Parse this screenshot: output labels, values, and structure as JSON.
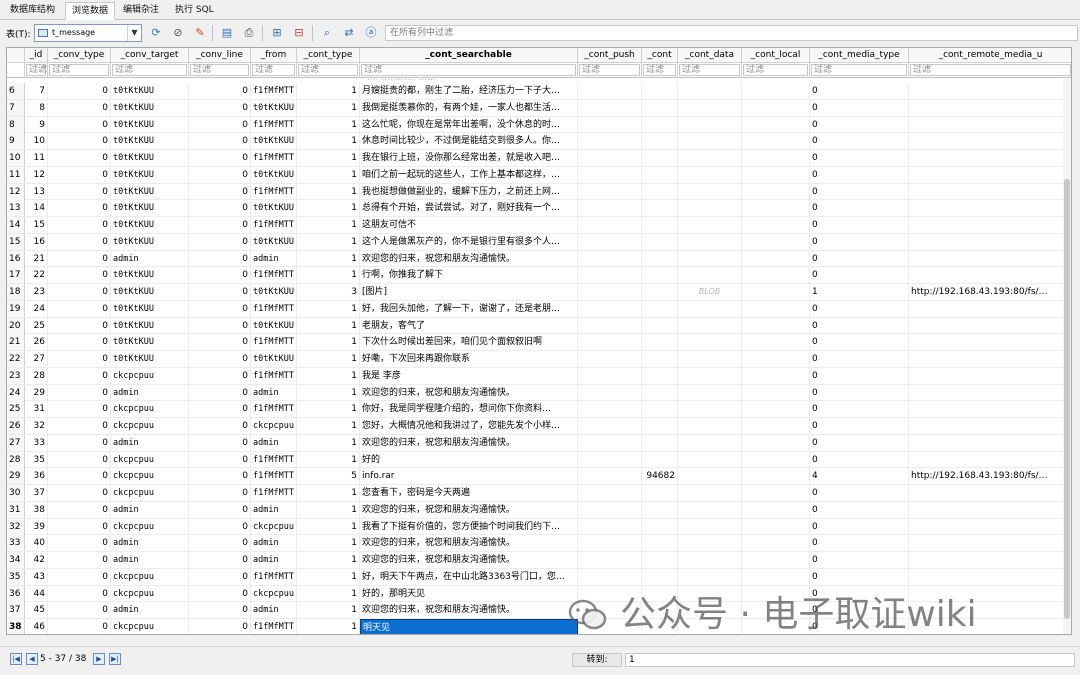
{
  "tabs": [
    "数据库结构",
    "浏览数据",
    "编辑杂注",
    "执行 SQL"
  ],
  "toolbar": {
    "table_label": "表(T):",
    "table_name": "t_message",
    "filter_all_placeholder": "在所有列中过滤"
  },
  "grid": {
    "columns": [
      "",
      "_id",
      "_conv_type",
      "_conv_target",
      "_conv_line",
      "_from",
      "_cont_type",
      "_cont_searchable",
      "_cont_push",
      "_cont",
      "_cont_data",
      "_cont_local",
      "_cont_media_type",
      "_cont_remote_media_u"
    ],
    "filter_placeholder": "过滤",
    "rows": [
      {
        "rn": "6",
        "id": "7",
        "conv_type": "0",
        "conv_target": "t0tKtKUU",
        "conv_line": "0",
        "from": "f1fMfMTT",
        "cont_type": "1",
        "searchable": "月嫂挺贵的都，刚生了二胎，经济压力一下子大…",
        "push": "",
        "cont": "",
        "data": "",
        "local": "",
        "media_type": "0",
        "remote": ""
      },
      {
        "rn": "7",
        "id": "8",
        "conv_type": "0",
        "conv_target": "t0tKtKUU",
        "conv_line": "0",
        "from": "t0tKtKUU",
        "cont_type": "1",
        "searchable": "我倒是挺羡慕你的，有两个娃，一家人也都生活…",
        "push": "",
        "cont": "",
        "data": "",
        "local": "",
        "media_type": "0",
        "remote": ""
      },
      {
        "rn": "8",
        "id": "9",
        "conv_type": "0",
        "conv_target": "t0tKtKUU",
        "conv_line": "0",
        "from": "f1fMfMTT",
        "cont_type": "1",
        "searchable": "这么忙呢，你现在是常年出差啊，没个休息的时…",
        "push": "",
        "cont": "",
        "data": "",
        "local": "",
        "media_type": "0",
        "remote": ""
      },
      {
        "rn": "9",
        "id": "10",
        "conv_type": "0",
        "conv_target": "t0tKtKUU",
        "conv_line": "0",
        "from": "t0tKtKUU",
        "cont_type": "1",
        "searchable": "休息时间比较少，不过倒是能结交到很多人。你…",
        "push": "",
        "cont": "",
        "data": "",
        "local": "",
        "media_type": "0",
        "remote": ""
      },
      {
        "rn": "10",
        "id": "11",
        "conv_type": "0",
        "conv_target": "t0tKtKUU",
        "conv_line": "0",
        "from": "f1fMfMTT",
        "cont_type": "1",
        "searchable": "我在银行上班，没你那么经常出差，就是收入吧…",
        "push": "",
        "cont": "",
        "data": "",
        "local": "",
        "media_type": "0",
        "remote": ""
      },
      {
        "rn": "11",
        "id": "12",
        "conv_type": "0",
        "conv_target": "t0tKtKUU",
        "conv_line": "0",
        "from": "t0tKtKUU",
        "cont_type": "1",
        "searchable": "咱们之前一起玩的这些人，工作上基本都这样，…",
        "push": "",
        "cont": "",
        "data": "",
        "local": "",
        "media_type": "0",
        "remote": ""
      },
      {
        "rn": "12",
        "id": "13",
        "conv_type": "0",
        "conv_target": "t0tKtKUU",
        "conv_line": "0",
        "from": "f1fMfMTT",
        "cont_type": "1",
        "searchable": "我也挺想做做副业的，缓解下压力，之前还上网…",
        "push": "",
        "cont": "",
        "data": "",
        "local": "",
        "media_type": "0",
        "remote": ""
      },
      {
        "rn": "13",
        "id": "14",
        "conv_type": "0",
        "conv_target": "t0tKtKUU",
        "conv_line": "0",
        "from": "t0tKtKUU",
        "cont_type": "1",
        "searchable": "总得有个开始，尝试尝试。对了，刚好我有一个…",
        "push": "",
        "cont": "",
        "data": "",
        "local": "",
        "media_type": "0",
        "remote": ""
      },
      {
        "rn": "14",
        "id": "15",
        "conv_type": "0",
        "conv_target": "t0tKtKUU",
        "conv_line": "0",
        "from": "f1fMfMTT",
        "cont_type": "1",
        "searchable": "这朋友可信不",
        "push": "",
        "cont": "",
        "data": "",
        "local": "",
        "media_type": "0",
        "remote": ""
      },
      {
        "rn": "15",
        "id": "16",
        "conv_type": "0",
        "conv_target": "t0tKtKUU",
        "conv_line": "0",
        "from": "t0tKtKUU",
        "cont_type": "1",
        "searchable": "这个人是做黑灰产的，你不是银行里有很多个人…",
        "push": "",
        "cont": "",
        "data": "",
        "local": "",
        "media_type": "0",
        "remote": ""
      },
      {
        "rn": "16",
        "id": "21",
        "conv_type": "0",
        "conv_target": "admin",
        "conv_line": "0",
        "from": "admin",
        "cont_type": "1",
        "searchable": "欢迎您的归来，祝您和朋友沟通愉快。",
        "push": "",
        "cont": "",
        "data": "",
        "local": "",
        "media_type": "0",
        "remote": ""
      },
      {
        "rn": "17",
        "id": "22",
        "conv_type": "0",
        "conv_target": "t0tKtKUU",
        "conv_line": "0",
        "from": "f1fMfMTT",
        "cont_type": "1",
        "searchable": "行啊，你推我了解下",
        "push": "",
        "cont": "",
        "data": "",
        "local": "",
        "media_type": "0",
        "remote": ""
      },
      {
        "rn": "18",
        "id": "23",
        "conv_type": "0",
        "conv_target": "t0tKtKUU",
        "conv_line": "0",
        "from": "t0tKtKUU",
        "cont_type": "3",
        "searchable": "[图片]",
        "push": "",
        "cont": "",
        "data": "BLOB",
        "local": "",
        "media_type": "1",
        "remote": "http://192.168.43.193:80/fs/…"
      },
      {
        "rn": "19",
        "id": "24",
        "conv_type": "0",
        "conv_target": "t0tKtKUU",
        "conv_line": "0",
        "from": "f1fMfMTT",
        "cont_type": "1",
        "searchable": "好，我回头加他，了解一下，谢谢了，还是老朋…",
        "push": "",
        "cont": "",
        "data": "",
        "local": "",
        "media_type": "0",
        "remote": ""
      },
      {
        "rn": "20",
        "id": "25",
        "conv_type": "0",
        "conv_target": "t0tKtKUU",
        "conv_line": "0",
        "from": "t0tKtKUU",
        "cont_type": "1",
        "searchable": "老朋友，客气了",
        "push": "",
        "cont": "",
        "data": "",
        "local": "",
        "media_type": "0",
        "remote": ""
      },
      {
        "rn": "21",
        "id": "26",
        "conv_type": "0",
        "conv_target": "t0tKtKUU",
        "conv_line": "0",
        "from": "f1fMfMTT",
        "cont_type": "1",
        "searchable": "下次什么时候出差回来，咱们见个面叙叙旧啊",
        "push": "",
        "cont": "",
        "data": "",
        "local": "",
        "media_type": "0",
        "remote": ""
      },
      {
        "rn": "22",
        "id": "27",
        "conv_type": "0",
        "conv_target": "t0tKtKUU",
        "conv_line": "0",
        "from": "t0tKtKUU",
        "cont_type": "1",
        "searchable": "好嘞，下次回来再跟你联系",
        "push": "",
        "cont": "",
        "data": "",
        "local": "",
        "media_type": "0",
        "remote": ""
      },
      {
        "rn": "23",
        "id": "28",
        "conv_type": "0",
        "conv_target": "ckcpcpuu",
        "conv_line": "0",
        "from": "f1fMfMTT",
        "cont_type": "1",
        "searchable": "我是 李彦",
        "push": "",
        "cont": "",
        "data": "",
        "local": "",
        "media_type": "0",
        "remote": ""
      },
      {
        "rn": "24",
        "id": "29",
        "conv_type": "0",
        "conv_target": "admin",
        "conv_line": "0",
        "from": "admin",
        "cont_type": "1",
        "searchable": "欢迎您的归来，祝您和朋友沟通愉快。",
        "push": "",
        "cont": "",
        "data": "",
        "local": "",
        "media_type": "0",
        "remote": ""
      },
      {
        "rn": "25",
        "id": "31",
        "conv_type": "0",
        "conv_target": "ckcpcpuu",
        "conv_line": "0",
        "from": "f1fMfMTT",
        "cont_type": "1",
        "searchable": "你好，我是同学程隆介绍的，想问你下你资料…",
        "push": "",
        "cont": "",
        "data": "",
        "local": "",
        "media_type": "0",
        "remote": ""
      },
      {
        "rn": "26",
        "id": "32",
        "conv_type": "0",
        "conv_target": "ckcpcpuu",
        "conv_line": "0",
        "from": "ckcpcpuu",
        "cont_type": "1",
        "searchable": "您好，大概情况他和我讲过了，您能先发个小样…",
        "push": "",
        "cont": "",
        "data": "",
        "local": "",
        "media_type": "0",
        "remote": ""
      },
      {
        "rn": "27",
        "id": "33",
        "conv_type": "0",
        "conv_target": "admin",
        "conv_line": "0",
        "from": "admin",
        "cont_type": "1",
        "searchable": "欢迎您的归来，祝您和朋友沟通愉快。",
        "push": "",
        "cont": "",
        "data": "",
        "local": "",
        "media_type": "0",
        "remote": ""
      },
      {
        "rn": "28",
        "id": "35",
        "conv_type": "0",
        "conv_target": "ckcpcpuu",
        "conv_line": "0",
        "from": "f1fMfMTT",
        "cont_type": "1",
        "searchable": "好的",
        "push": "",
        "cont": "",
        "data": "",
        "local": "",
        "media_type": "0",
        "remote": ""
      },
      {
        "rn": "29",
        "id": "36",
        "conv_type": "0",
        "conv_target": "ckcpcpuu",
        "conv_line": "0",
        "from": "f1fMfMTT",
        "cont_type": "5",
        "searchable": "info.rar",
        "push": "",
        "cont": "94682",
        "data": "",
        "local": "",
        "media_type": "4",
        "remote": "http://192.168.43.193:80/fs/…"
      },
      {
        "rn": "30",
        "id": "37",
        "conv_type": "0",
        "conv_target": "ckcpcpuu",
        "conv_line": "0",
        "from": "f1fMfMTT",
        "cont_type": "1",
        "searchable": "您查看下，密码是今天两遍",
        "push": "",
        "cont": "",
        "data": "",
        "local": "",
        "media_type": "0",
        "remote": ""
      },
      {
        "rn": "31",
        "id": "38",
        "conv_type": "0",
        "conv_target": "admin",
        "conv_line": "0",
        "from": "admin",
        "cont_type": "1",
        "searchable": "欢迎您的归来，祝您和朋友沟通愉快。",
        "push": "",
        "cont": "",
        "data": "",
        "local": "",
        "media_type": "0",
        "remote": ""
      },
      {
        "rn": "32",
        "id": "39",
        "conv_type": "0",
        "conv_target": "ckcpcpuu",
        "conv_line": "0",
        "from": "ckcpcpuu",
        "cont_type": "1",
        "searchable": "我看了下挺有价值的，您方便抽个时间我们约下…",
        "push": "",
        "cont": "",
        "data": "",
        "local": "",
        "media_type": "0",
        "remote": ""
      },
      {
        "rn": "33",
        "id": "40",
        "conv_type": "0",
        "conv_target": "admin",
        "conv_line": "0",
        "from": "admin",
        "cont_type": "1",
        "searchable": "欢迎您的归来，祝您和朋友沟通愉快。",
        "push": "",
        "cont": "",
        "data": "",
        "local": "",
        "media_type": "0",
        "remote": ""
      },
      {
        "rn": "34",
        "id": "42",
        "conv_type": "0",
        "conv_target": "admin",
        "conv_line": "0",
        "from": "admin",
        "cont_type": "1",
        "searchable": "欢迎您的归来，祝您和朋友沟通愉快。",
        "push": "",
        "cont": "",
        "data": "",
        "local": "",
        "media_type": "0",
        "remote": ""
      },
      {
        "rn": "35",
        "id": "43",
        "conv_type": "0",
        "conv_target": "ckcpcpuu",
        "conv_line": "0",
        "from": "f1fMfMTT",
        "cont_type": "1",
        "searchable": "好，明天下午两点，在中山北路3363号门口，您…",
        "push": "",
        "cont": "",
        "data": "",
        "local": "",
        "media_type": "0",
        "remote": ""
      },
      {
        "rn": "36",
        "id": "44",
        "conv_type": "0",
        "conv_target": "ckcpcpuu",
        "conv_line": "0",
        "from": "ckcpcpuu",
        "cont_type": "1",
        "searchable": "好的，那明天见",
        "push": "",
        "cont": "",
        "data": "",
        "local": "",
        "media_type": "0",
        "remote": ""
      },
      {
        "rn": "37",
        "id": "45",
        "conv_type": "0",
        "conv_target": "admin",
        "conv_line": "0",
        "from": "admin",
        "cont_type": "1",
        "searchable": "欢迎您的归来，祝您和朋友沟通愉快。",
        "push": "",
        "cont": "",
        "data": "",
        "local": "",
        "media_type": "0",
        "remote": ""
      },
      {
        "rn": "38",
        "id": "46",
        "conv_type": "0",
        "conv_target": "ckcpcpuu",
        "conv_line": "0",
        "from": "f1fMfMTT",
        "cont_type": "1",
        "searchable": "明天见",
        "push": "",
        "cont": "",
        "data": "",
        "local": "",
        "media_type": "0",
        "remote": ""
      }
    ]
  },
  "watermark": "公众号 · 电子取证wiki",
  "status": {
    "pager_text": "5 - 37 / 38",
    "goto_label": "转到:",
    "goto_value": "1"
  }
}
